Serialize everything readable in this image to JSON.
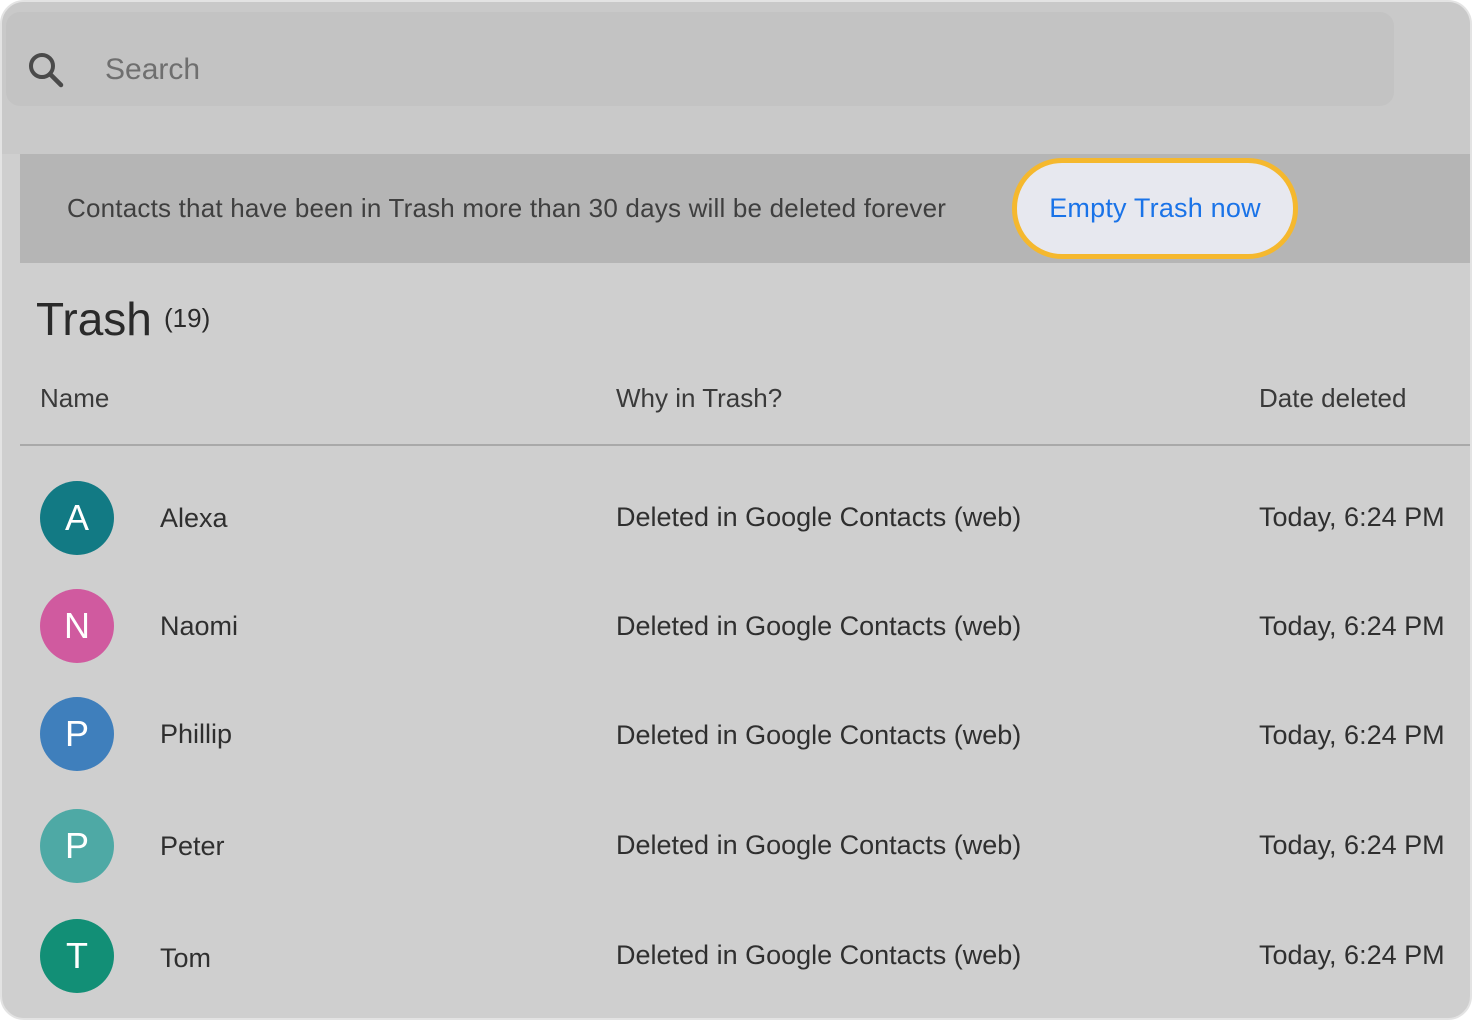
{
  "search": {
    "placeholder": "Search",
    "icon": "search-icon"
  },
  "banner": {
    "text": "Contacts that have been in Trash more than 30 days will be deleted forever",
    "button_label": "Empty Trash now",
    "button_highlight_color": "#f5b82e",
    "button_text_color": "#1a73e8"
  },
  "header": {
    "title": "Trash",
    "count": "(19)"
  },
  "table": {
    "columns": [
      "Name",
      "Why in Trash?",
      "Date deleted"
    ],
    "rows": [
      {
        "initial": "A",
        "name": "Alexa",
        "reason": "Deleted in Google Contacts (web)",
        "date": "Today, 6:24 PM",
        "avatar_color": "#127a84"
      },
      {
        "initial": "N",
        "name": "Naomi",
        "reason": "Deleted in Google Contacts (web)",
        "date": "Today, 6:24 PM",
        "avatar_color": "#d05a9f"
      },
      {
        "initial": "P",
        "name": "Phillip",
        "reason": "Deleted in Google Contacts (web)",
        "date": "Today, 6:24 PM",
        "avatar_color": "#3f7fbc"
      },
      {
        "initial": "P",
        "name": "Peter",
        "reason": "Deleted in Google Contacts (web)",
        "date": "Today, 6:24 PM",
        "avatar_color": "#4ea9a5"
      },
      {
        "initial": "T",
        "name": "Tom",
        "reason": "Deleted in Google Contacts (web)",
        "date": "Today, 6:24 PM",
        "avatar_color": "#128f76"
      }
    ]
  }
}
